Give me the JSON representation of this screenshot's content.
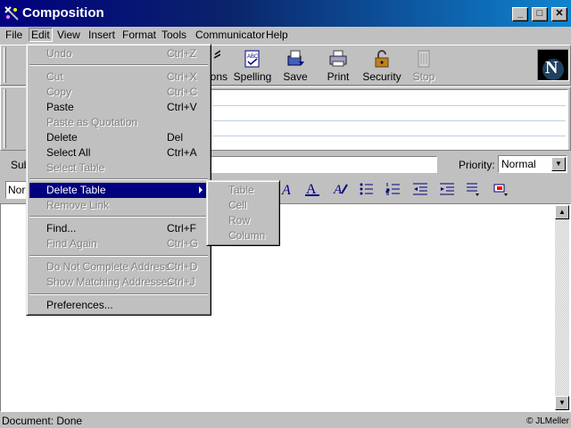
{
  "window": {
    "title": "Composition",
    "controls": {
      "minimize": "_",
      "maximize": "□",
      "close": "✕"
    }
  },
  "menubar": {
    "items": [
      {
        "label": "File"
      },
      {
        "label": "Edit"
      },
      {
        "label": "View"
      },
      {
        "label": "Insert"
      },
      {
        "label": "Format"
      },
      {
        "label": "Tools"
      },
      {
        "label": "Communicator"
      },
      {
        "label": "Help"
      }
    ]
  },
  "toolbar": {
    "buttons": [
      {
        "label": "ons",
        "icon": "options-icon"
      },
      {
        "label": "Spelling",
        "icon": "spelling-icon"
      },
      {
        "label": "Save",
        "icon": "save-icon"
      },
      {
        "label": "Print",
        "icon": "print-icon"
      },
      {
        "label": "Security",
        "icon": "security-icon"
      },
      {
        "label": "Stop",
        "icon": "stop-icon",
        "disabled": true
      }
    ],
    "logo_letter": "N"
  },
  "compose": {
    "subject_label": "Sub",
    "priority_label": "Priority:",
    "priority_value": "Normal",
    "style_value": "Nor"
  },
  "edit_menu": {
    "items": [
      {
        "label": "Undo",
        "shortcut": "Ctrl+Z",
        "disabled": true
      },
      {
        "label": "Cut",
        "shortcut": "Ctrl+X",
        "disabled": true
      },
      {
        "label": "Copy",
        "shortcut": "Ctrl+C",
        "disabled": true
      },
      {
        "label": "Paste",
        "shortcut": "Ctrl+V"
      },
      {
        "label": "Paste as Quotation",
        "shortcut": "",
        "disabled": true
      },
      {
        "label": "Delete",
        "shortcut": "Del"
      },
      {
        "label": "Select All",
        "shortcut": "Ctrl+A"
      },
      {
        "label": "Select Table",
        "shortcut": "",
        "disabled": true
      },
      {
        "label": "Delete Table",
        "shortcut": ""
      },
      {
        "label": "Remove Link",
        "shortcut": "",
        "disabled": true
      },
      {
        "label": "Find...",
        "shortcut": "Ctrl+F"
      },
      {
        "label": "Find Again",
        "shortcut": "Ctrl+G",
        "disabled": true
      },
      {
        "label": "Do Not Complete Address",
        "shortcut": "Ctrl+D",
        "disabled": true
      },
      {
        "label": "Show Matching Addresses",
        "shortcut": "Ctrl+J",
        "disabled": true
      },
      {
        "label": "Preferences...",
        "shortcut": ""
      }
    ]
  },
  "delete_table_submenu": {
    "items": [
      {
        "label": "Table",
        "disabled": true
      },
      {
        "label": "Cell",
        "disabled": true
      },
      {
        "label": "Row",
        "disabled": true
      },
      {
        "label": "Column",
        "disabled": true
      }
    ]
  },
  "statusbar": {
    "text": "Document: Done",
    "copyright": "© JLMeller"
  },
  "colors": {
    "titlebar": "#000080",
    "highlight": "#000080",
    "face": "#c0c0c0"
  }
}
